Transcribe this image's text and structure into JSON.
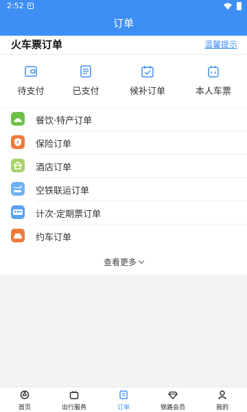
{
  "status_bar": {
    "time": "2:52"
  },
  "app_bar": {
    "title": "订单"
  },
  "train_section": {
    "title": "火车票订单",
    "tips_link": "温馨提示",
    "quick_actions": [
      {
        "label": "待支付",
        "icon": "wallet-icon"
      },
      {
        "label": "已支付",
        "icon": "receipt-icon"
      },
      {
        "label": "候补订单",
        "icon": "calendar-check-icon"
      },
      {
        "label": "本人车票",
        "icon": "ticket-bag-icon"
      }
    ]
  },
  "order_list": {
    "items": [
      {
        "label": "餐饮·特产订单",
        "icon": "dining-icon",
        "color": "#6cc14a"
      },
      {
        "label": "保险订单",
        "icon": "shield-icon",
        "color": "#f07a3b"
      },
      {
        "label": "酒店订单",
        "icon": "hotel-icon",
        "color": "#a7d36a"
      },
      {
        "label": "空铁联运订单",
        "icon": "air-rail-icon",
        "color": "#6fb2f5"
      },
      {
        "label": "计次·定期票订单",
        "icon": "bus-icon",
        "color": "#5aa2f2"
      },
      {
        "label": "约车订单",
        "icon": "car-icon",
        "color": "#f07a3b"
      }
    ],
    "more_label": "查看更多"
  },
  "tab_bar": {
    "items": [
      {
        "label": "首页",
        "icon": "home-icon",
        "active": false
      },
      {
        "label": "出行服务",
        "icon": "travel-service-icon",
        "active": false
      },
      {
        "label": "订单",
        "icon": "order-icon",
        "active": true
      },
      {
        "label": "铁路会员",
        "icon": "diamond-icon",
        "active": false
      },
      {
        "label": "我的",
        "icon": "profile-icon",
        "active": false
      }
    ]
  },
  "colors": {
    "accent": "#3d8ff5"
  }
}
